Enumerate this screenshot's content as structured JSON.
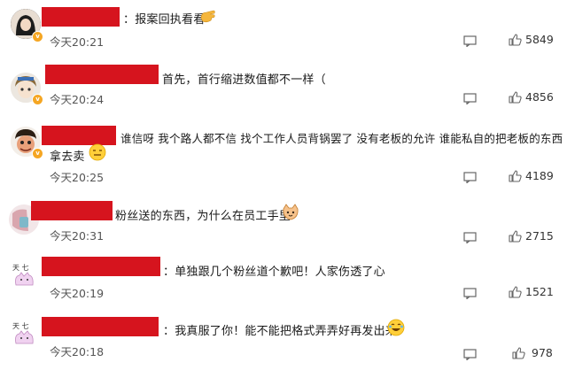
{
  "comments": [
    {
      "text": "：报案回执看看",
      "time": "今天20:21",
      "likes": "5849",
      "emoji": "hand"
    },
    {
      "text": "首先，首行缩进数值都不一样（",
      "time": "今天20:24",
      "likes": "4856",
      "emoji": ""
    },
    {
      "text": "谁信呀 我个路人都不信 找个工作人员背锅罢了 没有老板的允许 谁能私自的把老板的东西",
      "text2": "拿去卖",
      "time": "今天20:25",
      "likes": "4189",
      "emoji": "smile-flat"
    },
    {
      "text": "粉丝送的东西，为什么在员工手里",
      "time": "今天20:31",
      "likes": "2715",
      "emoji": "cat"
    },
    {
      "text": "：单独跟几个粉丝道个歉吧！人家伤透了心",
      "time": "今天20:19",
      "likes": "1521",
      "emoji": ""
    },
    {
      "text": "：我真服了你！能不能把格式弄弄好再发出来",
      "time": "今天20:18",
      "likes": "978",
      "emoji": "laugh"
    }
  ]
}
